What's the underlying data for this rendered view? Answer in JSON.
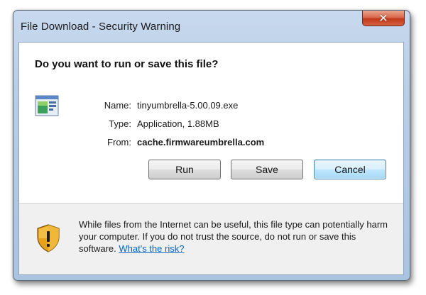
{
  "window": {
    "title": "File Download - Security Warning",
    "close_glyph": "✕"
  },
  "dialog": {
    "question": "Do you want to run or save this file?",
    "file": {
      "icon": "application-window-icon",
      "name_label": "Name:",
      "name_value": "tinyumbrella-5.00.09.exe",
      "type_label": "Type:",
      "type_value": "Application, 1.88MB",
      "from_label": "From:",
      "from_value": "cache.firmwareumbrella.com"
    },
    "buttons": {
      "run": "Run",
      "save": "Save",
      "cancel": "Cancel"
    }
  },
  "footer": {
    "icon": "security-shield-icon",
    "warning_text": "While files from the Internet can be useful, this file type can potentially harm your computer. If you do not trust the source, do not run or save this software.",
    "risk_link": "What's the risk?"
  },
  "colors": {
    "link": "#0066cc",
    "close_button": "#c0391c",
    "default_button_border": "#3c7fb1"
  }
}
